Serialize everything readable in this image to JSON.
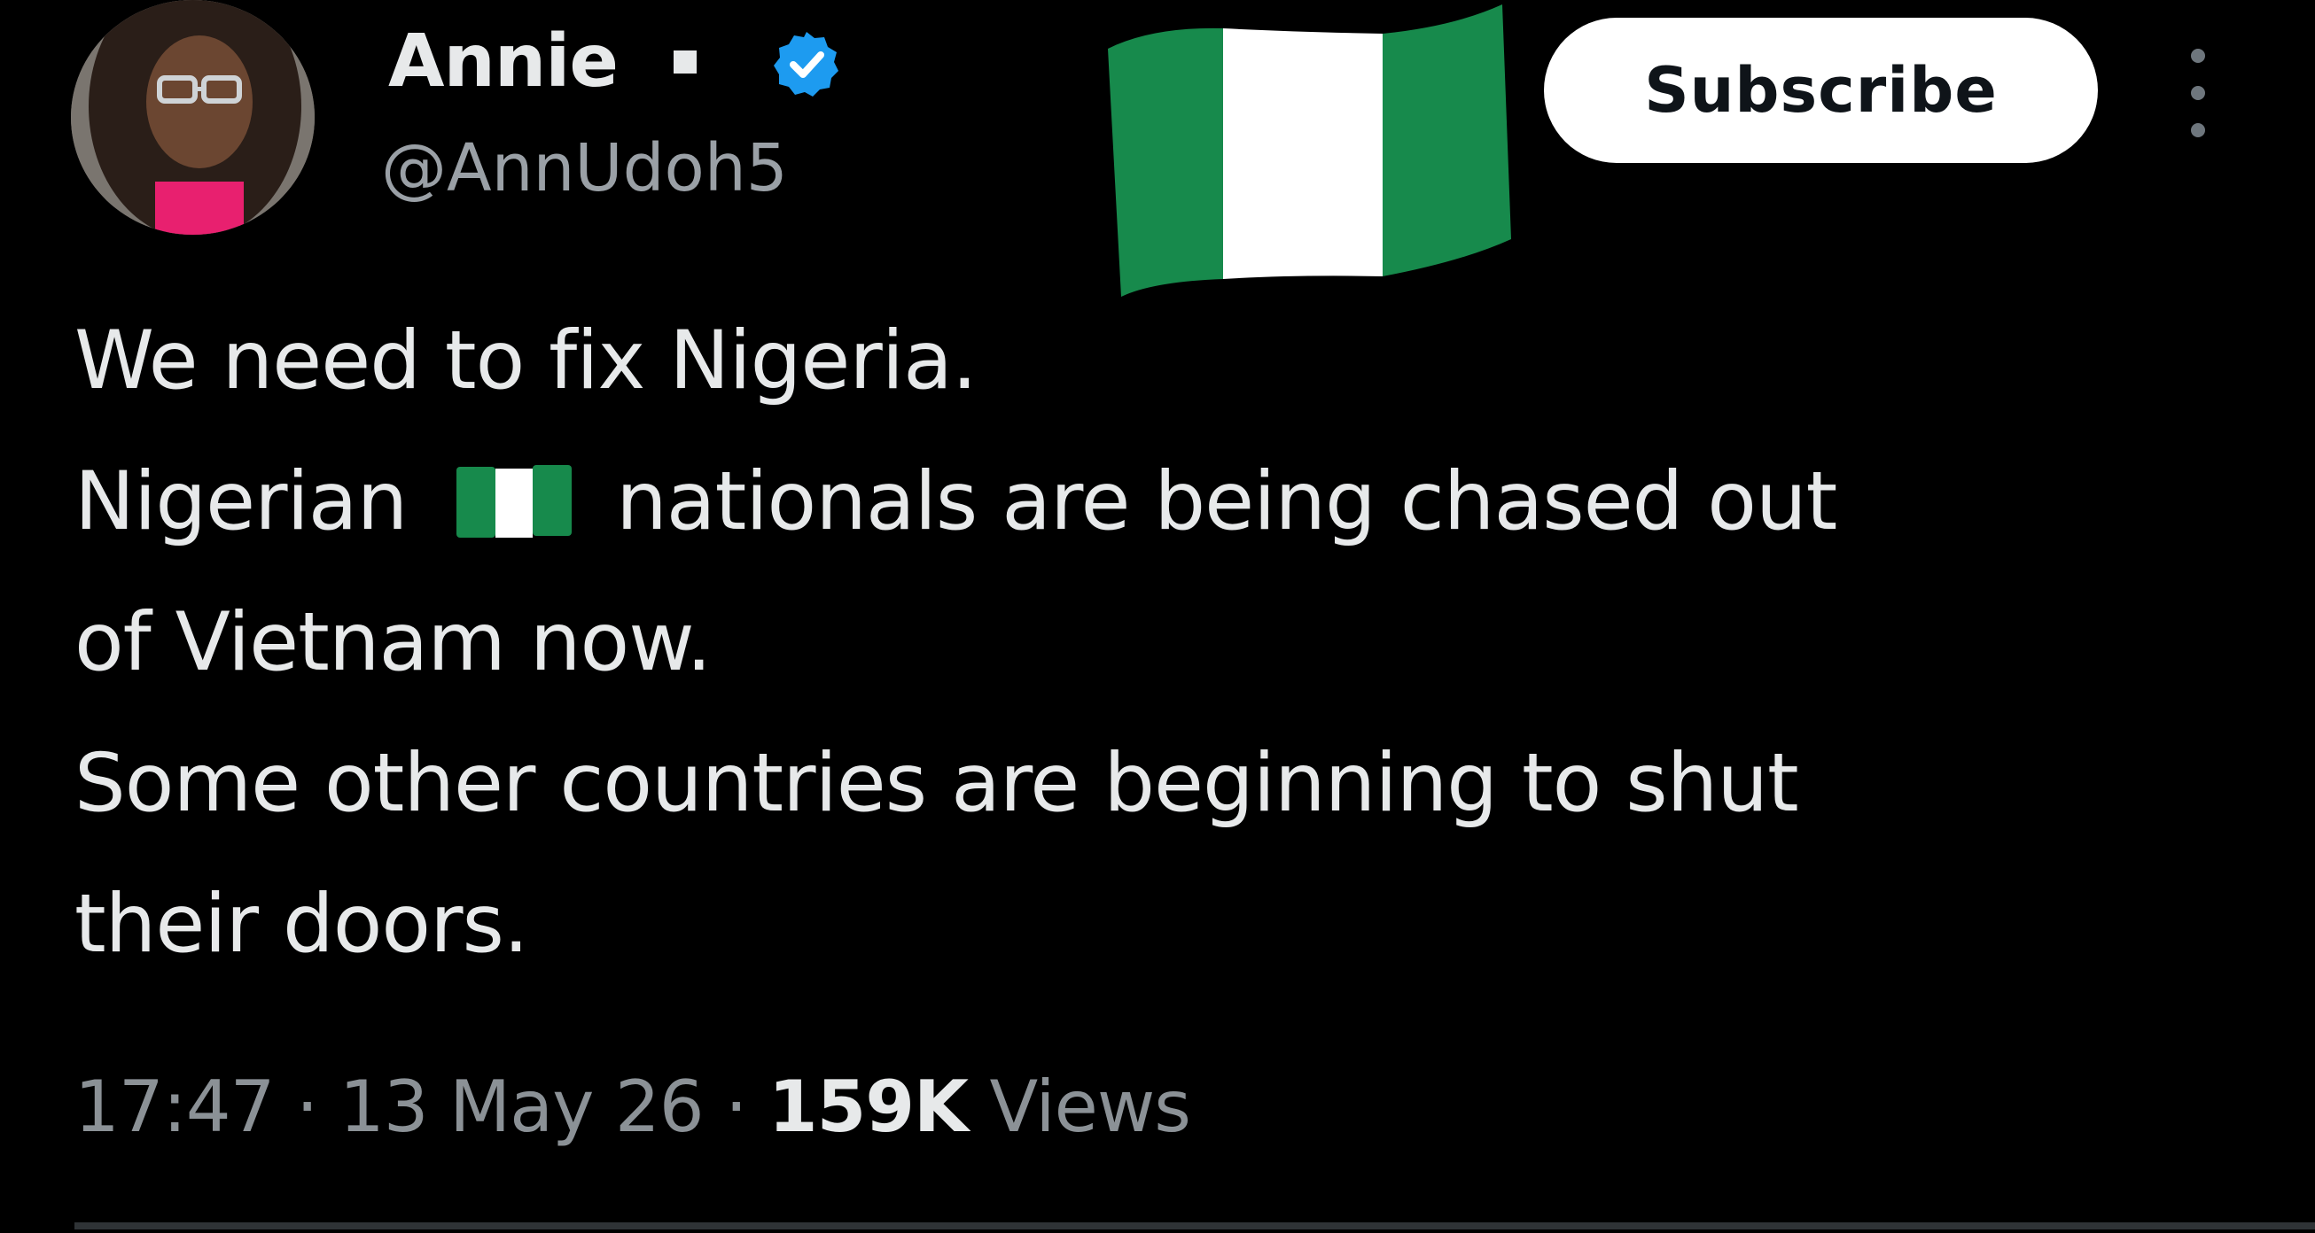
{
  "tweet": {
    "author": {
      "display_name": "Annie",
      "handle": "@AnnUdoh5"
    },
    "subscribe_label": "Subscribe",
    "text_lines": [
      "We need to fix Nigeria.",
      "Nigerian",
      "nationals are being chased out",
      "of Vietnam now.",
      "Some other countries are beginning to shut",
      "their doors."
    ],
    "meta": {
      "time": "17:47",
      "separator": "·",
      "date": "13 May 26",
      "views_count": "159K",
      "views_label": "Views"
    }
  },
  "colors": {
    "background": "#000000",
    "primary_text": "#e7e9ea",
    "secondary_text": "#9aa0a6",
    "verified_blue": "#1d9bf0",
    "flag_green": "#178a4c",
    "button_bg": "#ffffff"
  },
  "icons": {
    "verified": "verified-badge-icon",
    "flag": "nigeria-flag-icon",
    "more": "more-options-icon"
  }
}
